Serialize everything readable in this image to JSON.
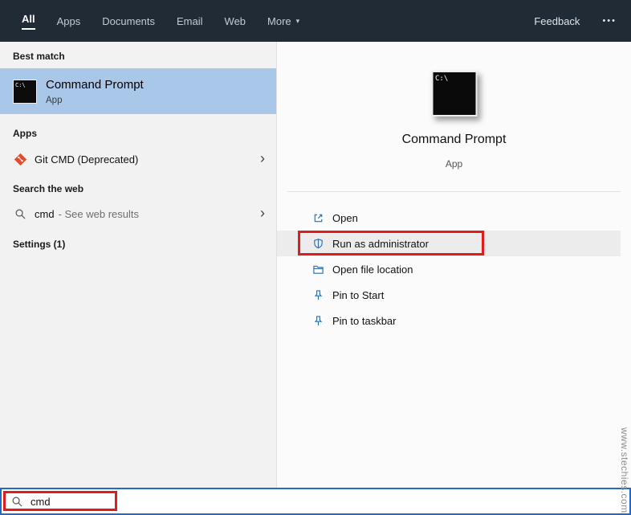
{
  "colors": {
    "topbar_bg": "#202b36",
    "highlight_blue": "#a9c8e9",
    "annotation_red": "#e01c1c",
    "focus_border_blue": "#2668c5"
  },
  "icons": {
    "chevron_right": "›",
    "dropdown_arrow": "▾",
    "overflow": "•••",
    "prompt_small": "C:\\",
    "prompt_large": "C:\\"
  },
  "topbar": {
    "tabs": [
      {
        "label": "All"
      },
      {
        "label": "Apps"
      },
      {
        "label": "Documents"
      },
      {
        "label": "Email"
      },
      {
        "label": "Web"
      },
      {
        "label": "More"
      }
    ],
    "feedback_label": "Feedback"
  },
  "left_panel": {
    "best_match_header": "Best match",
    "best_match_item": {
      "title": "Command Prompt",
      "subtitle": "App"
    },
    "apps_header": "Apps",
    "apps_item": {
      "label": "Git CMD (Deprecated)"
    },
    "web_header": "Search the web",
    "web_item": {
      "query": "cmd",
      "suffix": "- See web results"
    },
    "settings_header": "Settings (1)"
  },
  "right_panel": {
    "title": "Command Prompt",
    "subtitle": "App",
    "actions": [
      {
        "label": "Open"
      },
      {
        "label": "Run as administrator"
      },
      {
        "label": "Open file location"
      },
      {
        "label": "Pin to Start"
      },
      {
        "label": "Pin to taskbar"
      }
    ]
  },
  "search_bar": {
    "value": "cmd"
  },
  "watermark": "www.stechies.com"
}
